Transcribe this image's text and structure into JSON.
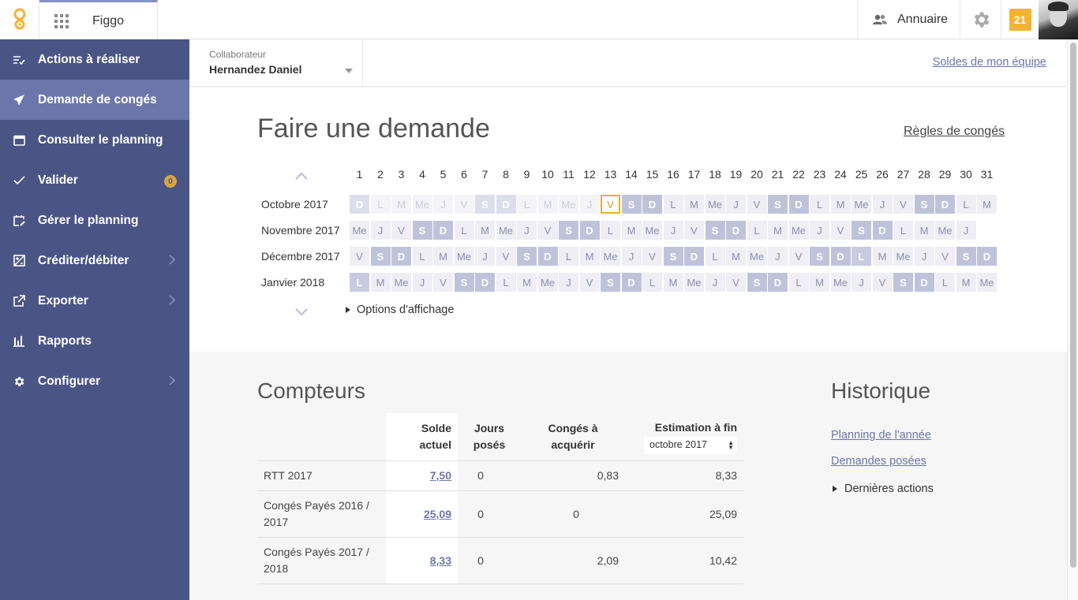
{
  "topbar": {
    "app_name": "Figgo",
    "annuaire": "Annuaire",
    "notif_count": "21"
  },
  "sidebar": {
    "items": [
      {
        "label": "Actions à réaliser",
        "icon": "list-check-icon"
      },
      {
        "label": "Demande de congés",
        "icon": "paper-plane-icon",
        "active": true
      },
      {
        "label": "Consulter le planning",
        "icon": "calendar-icon"
      },
      {
        "label": "Valider",
        "icon": "checkmark-icon",
        "badge": "0"
      },
      {
        "label": "Gérer le planning",
        "icon": "calendar-edit-icon"
      },
      {
        "label": "Créditer/débiter",
        "icon": "plus-minus-icon",
        "chevron": true
      },
      {
        "label": "Exporter",
        "icon": "export-icon",
        "chevron": true
      },
      {
        "label": "Rapports",
        "icon": "bar-chart-icon"
      },
      {
        "label": "Configurer",
        "icon": "gear-icon",
        "chevron": true
      }
    ]
  },
  "header": {
    "collab_label": "Collaborateur",
    "collab_value": "Hernandez Daniel",
    "soldes_link": "Soldes de mon équipe"
  },
  "request": {
    "title": "Faire une demande",
    "rules_link": "Règles de congés",
    "options_label": "Options d'affichage"
  },
  "calendar": {
    "days": [
      "1",
      "2",
      "3",
      "4",
      "5",
      "6",
      "7",
      "8",
      "9",
      "10",
      "11",
      "12",
      "13",
      "14",
      "15",
      "16",
      "17",
      "18",
      "19",
      "20",
      "21",
      "22",
      "23",
      "24",
      "25",
      "26",
      "27",
      "28",
      "29",
      "30",
      "31"
    ],
    "months": [
      {
        "label": "Octobre 2017",
        "cells": [
          "D",
          "L",
          "M",
          "Me",
          "J",
          "V",
          "S",
          "D",
          "L",
          "M",
          "Me",
          "J",
          "V",
          "S",
          "D",
          "L",
          "M",
          "Me",
          "J",
          "V",
          "S",
          "D",
          "L",
          "M",
          "Me",
          "J",
          "V",
          "S",
          "D",
          "L",
          "M"
        ],
        "today_index": 12
      },
      {
        "label": "Novembre 2017",
        "cells": [
          "Me",
          "J",
          "V",
          "S",
          "D",
          "L",
          "M",
          "Me",
          "J",
          "V",
          "S",
          "D",
          "L",
          "M",
          "Me",
          "J",
          "V",
          "S",
          "D",
          "L",
          "M",
          "Me",
          "J",
          "V",
          "S",
          "D",
          "L",
          "M",
          "Me",
          "J"
        ]
      },
      {
        "label": "Décembre 2017",
        "cells": [
          "V",
          "S",
          "D",
          "L",
          "M",
          "Me",
          "J",
          "V",
          "S",
          "D",
          "L",
          "M",
          "Me",
          "J",
          "V",
          "S",
          "D",
          "L",
          "M",
          "Me",
          "J",
          "V",
          "S",
          "D",
          "L",
          "M",
          "Me",
          "J",
          "V",
          "S",
          "D"
        ],
        "holiday_index": 24
      },
      {
        "label": "Janvier 2018",
        "cells": [
          "L",
          "M",
          "Me",
          "J",
          "V",
          "S",
          "D",
          "L",
          "M",
          "Me",
          "J",
          "V",
          "S",
          "D",
          "L",
          "M",
          "Me",
          "J",
          "V",
          "S",
          "D",
          "L",
          "M",
          "Me",
          "J",
          "V",
          "S",
          "D",
          "L",
          "M",
          "Me"
        ],
        "holiday_index": 0
      }
    ]
  },
  "counters": {
    "title": "Compteurs",
    "headers": {
      "solde_line1": "Solde",
      "solde_line2": "actuel",
      "jours_line1": "Jours",
      "jours_line2": "posés",
      "acq_line1": "Congés à",
      "acq_line2": "acquérir",
      "est_label": "Estimation à fin",
      "est_select": "octobre 2017"
    },
    "rows": [
      {
        "name": "RTT 2017",
        "solde": "7,50",
        "jours": "0",
        "acq": "0,83",
        "est": "8,33"
      },
      {
        "name_line1": "Congés Payés 2016 /",
        "name_line2": "2017",
        "solde": "25,09",
        "jours": "0",
        "acq": "0",
        "est": "25,09"
      },
      {
        "name_line1": "Congés Payés 2017 /",
        "name_line2": "2018",
        "solde": "8,33",
        "jours": "0",
        "acq": "2,09",
        "est": "10,42"
      }
    ]
  },
  "history": {
    "title": "Historique",
    "link1": "Planning de l'année",
    "link2": "Demandes posées",
    "actions": "Dernières actions"
  }
}
